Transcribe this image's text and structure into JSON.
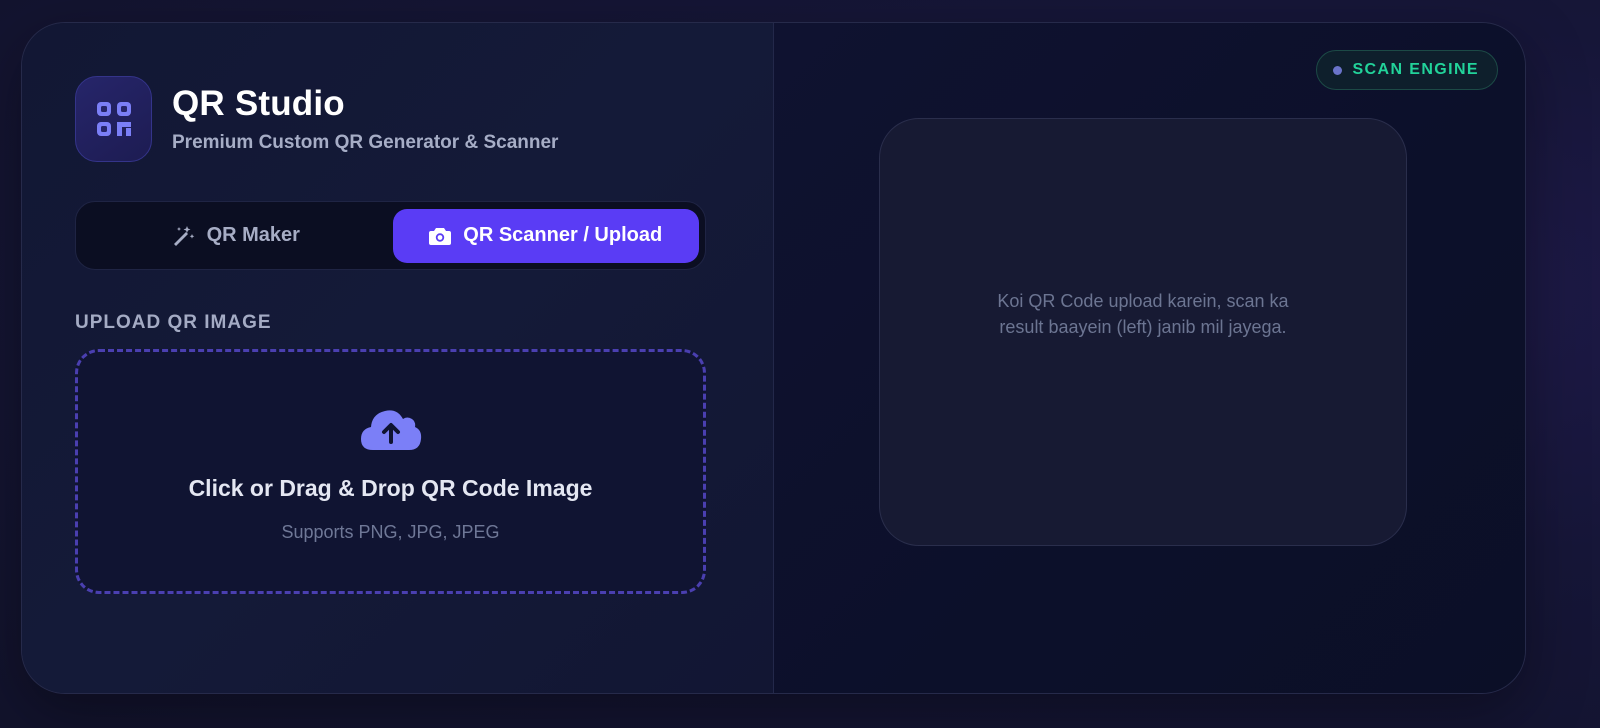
{
  "brand": {
    "title": "QR Studio",
    "subtitle": "Premium Custom QR Generator & Scanner",
    "logo_icon": "qrcode-icon"
  },
  "tabs": [
    {
      "label": "QR Maker",
      "icon": "magic-wand-icon",
      "active": false
    },
    {
      "label": "QR Scanner / Upload",
      "icon": "camera-icon",
      "active": true
    }
  ],
  "upload": {
    "section_label": "UPLOAD QR IMAGE",
    "title": "Click or Drag & Drop QR Code Image",
    "subtitle": "Supports PNG, JPG, JPEG",
    "icon": "cloud-upload-icon"
  },
  "status": {
    "badge": "SCAN ENGINE",
    "color": "#22d39a"
  },
  "result": {
    "placeholder": "Koi QR Code upload karein, scan ka result baayein (left) janib mil jayega."
  },
  "colors": {
    "accent": "#5a3cf5",
    "icon_accent": "#7b7ff7",
    "background": "#111530"
  }
}
